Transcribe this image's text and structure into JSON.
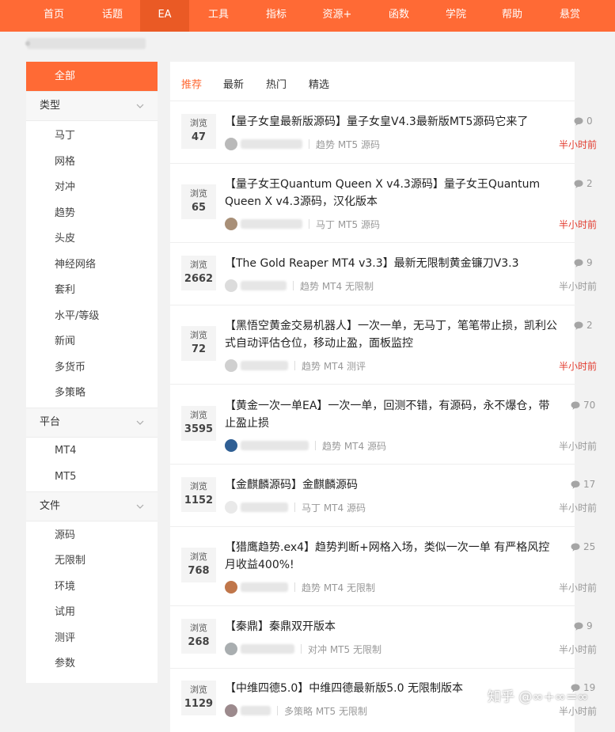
{
  "nav": {
    "items": [
      "首页",
      "话题",
      "EA",
      "工具",
      "指标",
      "资源+",
      "函数",
      "学院",
      "帮助",
      "悬赏"
    ],
    "active": "EA",
    "accent": "#ff6a35"
  },
  "sidebar": {
    "all_label": "全部",
    "sections": [
      {
        "title": "类型",
        "items": [
          "马丁",
          "网格",
          "对冲",
          "趋势",
          "头皮",
          "神经网络",
          "套利",
          "水平/等级",
          "新闻",
          "多货币",
          "多策略"
        ]
      },
      {
        "title": "平台",
        "items": [
          "MT4",
          "MT5"
        ]
      },
      {
        "title": "文件",
        "items": [
          "源码",
          "无限制",
          "环境",
          "试用",
          "测评",
          "参数"
        ]
      }
    ]
  },
  "tabs": [
    "推荐",
    "最新",
    "热门",
    "精选"
  ],
  "active_tab": "推荐",
  "views_label": "浏览",
  "posts": [
    {
      "views": "47",
      "title": "【量子女皇最新版源码】量子女皇V4.3最新版MT5源码它来了",
      "comments": "0",
      "tags": "趋势 MT5 源码",
      "time": "半小时前",
      "time_color": "#e23b2e",
      "avatar_color": "#b9b9b9"
    },
    {
      "views": "65",
      "title": "【量子女王Quantum Queen X v4.3源码】量子女王Quantum Queen X v4.3源码，汉化版本",
      "comments": "2",
      "tags": "马丁 MT5 源码",
      "time": "半小时前",
      "time_color": "#e23b2e",
      "avatar_color": "#a88f77"
    },
    {
      "views": "2662",
      "title": "【The Gold Reaper MT4 v3.3】最新无限制黄金镰刀V3.3",
      "comments": "9",
      "tags": "趋势 MT4 无限制",
      "time": "半小时前",
      "time_color": "#999999",
      "avatar_color": "#dcdcdc"
    },
    {
      "views": "72",
      "title": "【黑悟空黄金交易机器人】一次一单，无马丁，笔笔带止损，凯利公式自动评估仓位，移动止盈，面板监控",
      "comments": "2",
      "tags": "趋势 MT4 测评",
      "time": "半小时前",
      "time_color": "#e23b2e",
      "avatar_color": "#d0d0d0"
    },
    {
      "views": "3595",
      "title": "【黄金一次一单EA】一次一单，回测不错，有源码，永不爆仓，带止盈止损",
      "comments": "70",
      "tags": "趋势 MT4 源码",
      "time": "半小时前",
      "time_color": "#999999",
      "avatar_color": "#2f5f94"
    },
    {
      "views": "1152",
      "title": "【金麒麟源码】金麒麟源码",
      "comments": "17",
      "tags": "马丁 MT4 源码",
      "time": "半小时前",
      "time_color": "#999999",
      "avatar_color": "#e9e9e9"
    },
    {
      "views": "768",
      "title": "【猎鹰趋势.ex4】趋势判断+网格入场，类似一次一单 有严格风控 月收益400%!",
      "comments": "25",
      "tags": "趋势 MT4 无限制",
      "time": "半小时前",
      "time_color": "#999999",
      "avatar_color": "#c0764a"
    },
    {
      "views": "268",
      "title": "【秦鼎】秦鼎双开版本",
      "comments": "9",
      "tags": "对冲 MT5 无限制",
      "time": "半小时前",
      "time_color": "#999999",
      "avatar_color": "#a9aeb0"
    },
    {
      "views": "1129",
      "title": "【中维四德5.0】中维四德最新版5.0 无限制版本",
      "comments": "19",
      "tags": "多策略 MT5 无限制",
      "time": "半小时前",
      "time_color": "#999999",
      "avatar_color": "#9c8a8d"
    }
  ],
  "watermark": "知乎 @∞+∞=∞"
}
